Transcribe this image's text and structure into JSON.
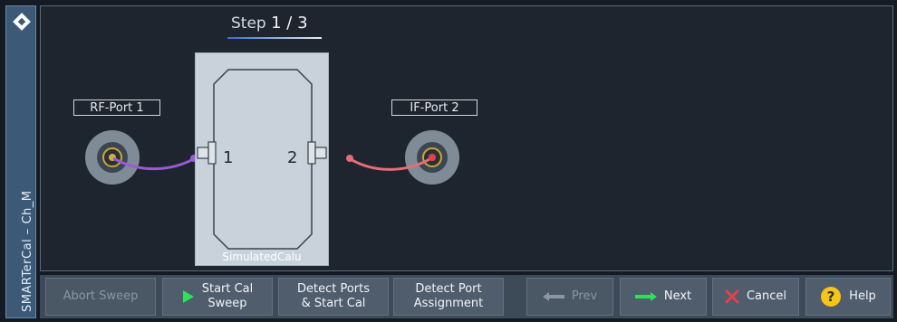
{
  "window": {
    "vertical_title": "SMARTerCal – Ch_M"
  },
  "wizard": {
    "step_prefix": "Step",
    "step_value": "1 / 3",
    "ports": [
      {
        "label": "RF-Port 1",
        "cable_color": "#9b5ad8"
      },
      {
        "label": "IF-Port 2",
        "cable_color": "#e86c7c"
      }
    ],
    "dut": {
      "name": "SimulatedCalu",
      "port_left": "1",
      "port_right": "2"
    }
  },
  "toolbar": {
    "abort_sweep": "Abort Sweep",
    "start_cal_sweep_l1": "Start Cal",
    "start_cal_sweep_l2": "Sweep",
    "detect_ports_l1": "Detect Ports",
    "detect_ports_l2": "& Start Cal",
    "detect_assign_l1": "Detect Port",
    "detect_assign_l2": "Assignment",
    "prev": "Prev",
    "next": "Next",
    "cancel": "Cancel",
    "help": "Help"
  },
  "colors": {
    "accent_green": "#2ee05a",
    "cancel_red": "#e8404a",
    "help_yellow": "#f5c518"
  }
}
